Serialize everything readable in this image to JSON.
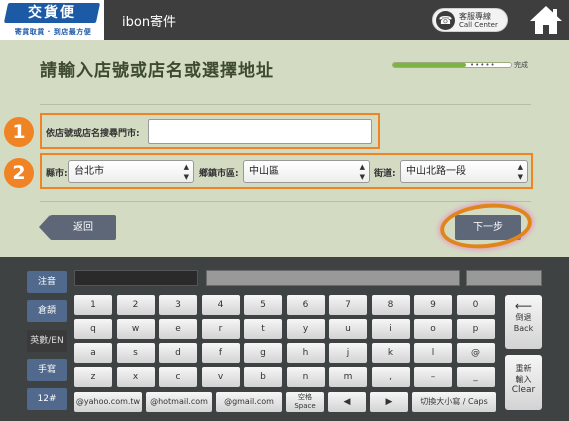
{
  "header": {
    "logo_main": "交貨便",
    "logo_sub": "寄貨取貨 · 到店最方便",
    "title": "ibon寄件",
    "call_center_line1": "客服專線",
    "call_center_line2": "Call Center",
    "home_icon": "home-icon",
    "phone_icon": "phone-icon"
  },
  "main": {
    "title": "請輸入店號或店名或選擇地址",
    "progress": {
      "fraction": 0.62,
      "label": "完成"
    },
    "step1": {
      "number": "1",
      "label": "依店號或店名搜尋門市:",
      "value": ""
    },
    "step2": {
      "number": "2",
      "county_label": "縣市:",
      "county_value": "台北市",
      "district_label": "鄉鎮市區:",
      "district_value": "中山區",
      "street_label": "街道:",
      "street_value": "中山北路一段"
    },
    "back_label": "返回",
    "next_label": "下一步"
  },
  "keyboard": {
    "side": [
      "注音",
      "倉頡",
      "英數/EN",
      "手寫",
      "12#"
    ],
    "active_side": "英數/EN",
    "rows": [
      [
        "1",
        "2",
        "3",
        "4",
        "5",
        "6",
        "7",
        "8",
        "9",
        "0"
      ],
      [
        "q",
        "w",
        "e",
        "r",
        "t",
        "y",
        "u",
        "i",
        "o",
        "p"
      ],
      [
        "a",
        "s",
        "d",
        "f",
        "g",
        "h",
        "j",
        "k",
        "l",
        "@"
      ],
      [
        "z",
        "x",
        "c",
        "v",
        "b",
        "n",
        "m",
        ",",
        "–",
        "_"
      ]
    ],
    "bottom": {
      "yahoo": "@yahoo.com.tw",
      "hotmail": "@hotmail.com",
      "gmail": "@gmail.com",
      "space_line1": "空格",
      "space_line2": "Space",
      "left": "◀",
      "right": "▶",
      "caps": "切換大小寫 / Caps"
    },
    "backspace_line1": "倒退",
    "backspace_line2": "Back",
    "clear_line1": "重新",
    "clear_line2": "輸入",
    "clear_line3": "Clear",
    "backspace_arrow": "⟵"
  },
  "colors": {
    "accent_orange": "#f08424",
    "key_blue": "#50698c",
    "bg_green": "#d3dcc3"
  }
}
